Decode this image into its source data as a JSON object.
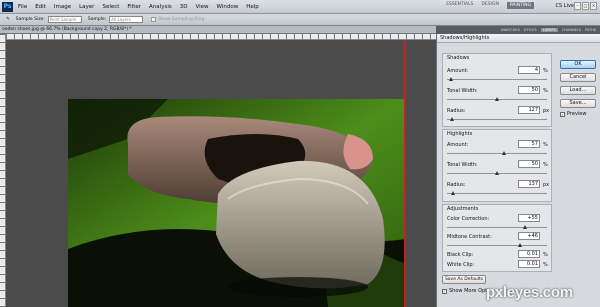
{
  "menubar": {
    "logo": "Ps",
    "items": [
      "File",
      "Edit",
      "Image",
      "Layer",
      "Select",
      "Filter",
      "Analysis",
      "3D",
      "View",
      "Window",
      "Help"
    ],
    "workspaces": [
      "ESSENTIALS",
      "DESIGN",
      "PAINTING"
    ],
    "cslive": "CS Live"
  },
  "options": {
    "sample_size_label": "Sample Size:",
    "sample_size_value": "Point Sample",
    "sample_label": "Sample:",
    "sample_value": "All Layers",
    "show_ring": "Show Sampling Ring"
  },
  "document": {
    "tab_title": "ooden shoes.jpg @ 66.7% (Background copy 2, RGB/8*) *"
  },
  "panels": {
    "tabs": [
      "SWATCHES",
      "STYLES",
      "LAYERS",
      "CHANNELS",
      "PATHS"
    ]
  },
  "dialog": {
    "title": "Shadows/Highlights",
    "shadows": {
      "title": "Shadows",
      "amount": {
        "label": "Amount:",
        "value": "4",
        "unit": "%",
        "level": 0.04
      },
      "tonal_width": {
        "label": "Tonal Width:",
        "value": "50",
        "unit": "%",
        "level": 0.5
      },
      "radius": {
        "label": "Radius:",
        "value": "127",
        "unit": "px",
        "level": 0.05
      }
    },
    "highlights": {
      "title": "Highlights",
      "amount": {
        "label": "Amount:",
        "value": "57",
        "unit": "%",
        "level": 0.57
      },
      "tonal_width": {
        "label": "Tonal Width:",
        "value": "50",
        "unit": "%",
        "level": 0.5
      },
      "radius": {
        "label": "Radius:",
        "value": "137",
        "unit": "px",
        "level": 0.055
      }
    },
    "adjustments": {
      "title": "Adjustments",
      "color_correction": {
        "label": "Color Correction:",
        "value": "+55",
        "level": 0.78
      },
      "midtone_contrast": {
        "label": "Midtone Contrast:",
        "value": "+46",
        "level": 0.73
      },
      "black_clip": {
        "label": "Black Clip:",
        "value": "0.01",
        "unit": "%"
      },
      "white_clip": {
        "label": "White Clip:",
        "value": "0.01",
        "unit": "%"
      }
    },
    "buttons": {
      "ok": "OK",
      "cancel": "Cancel",
      "load": "Load...",
      "save": "Save..."
    },
    "preview_label": "Preview",
    "save_defaults": "Save As Defaults",
    "show_more": "Show More Opti"
  },
  "watermark": "pxleyes.com"
}
